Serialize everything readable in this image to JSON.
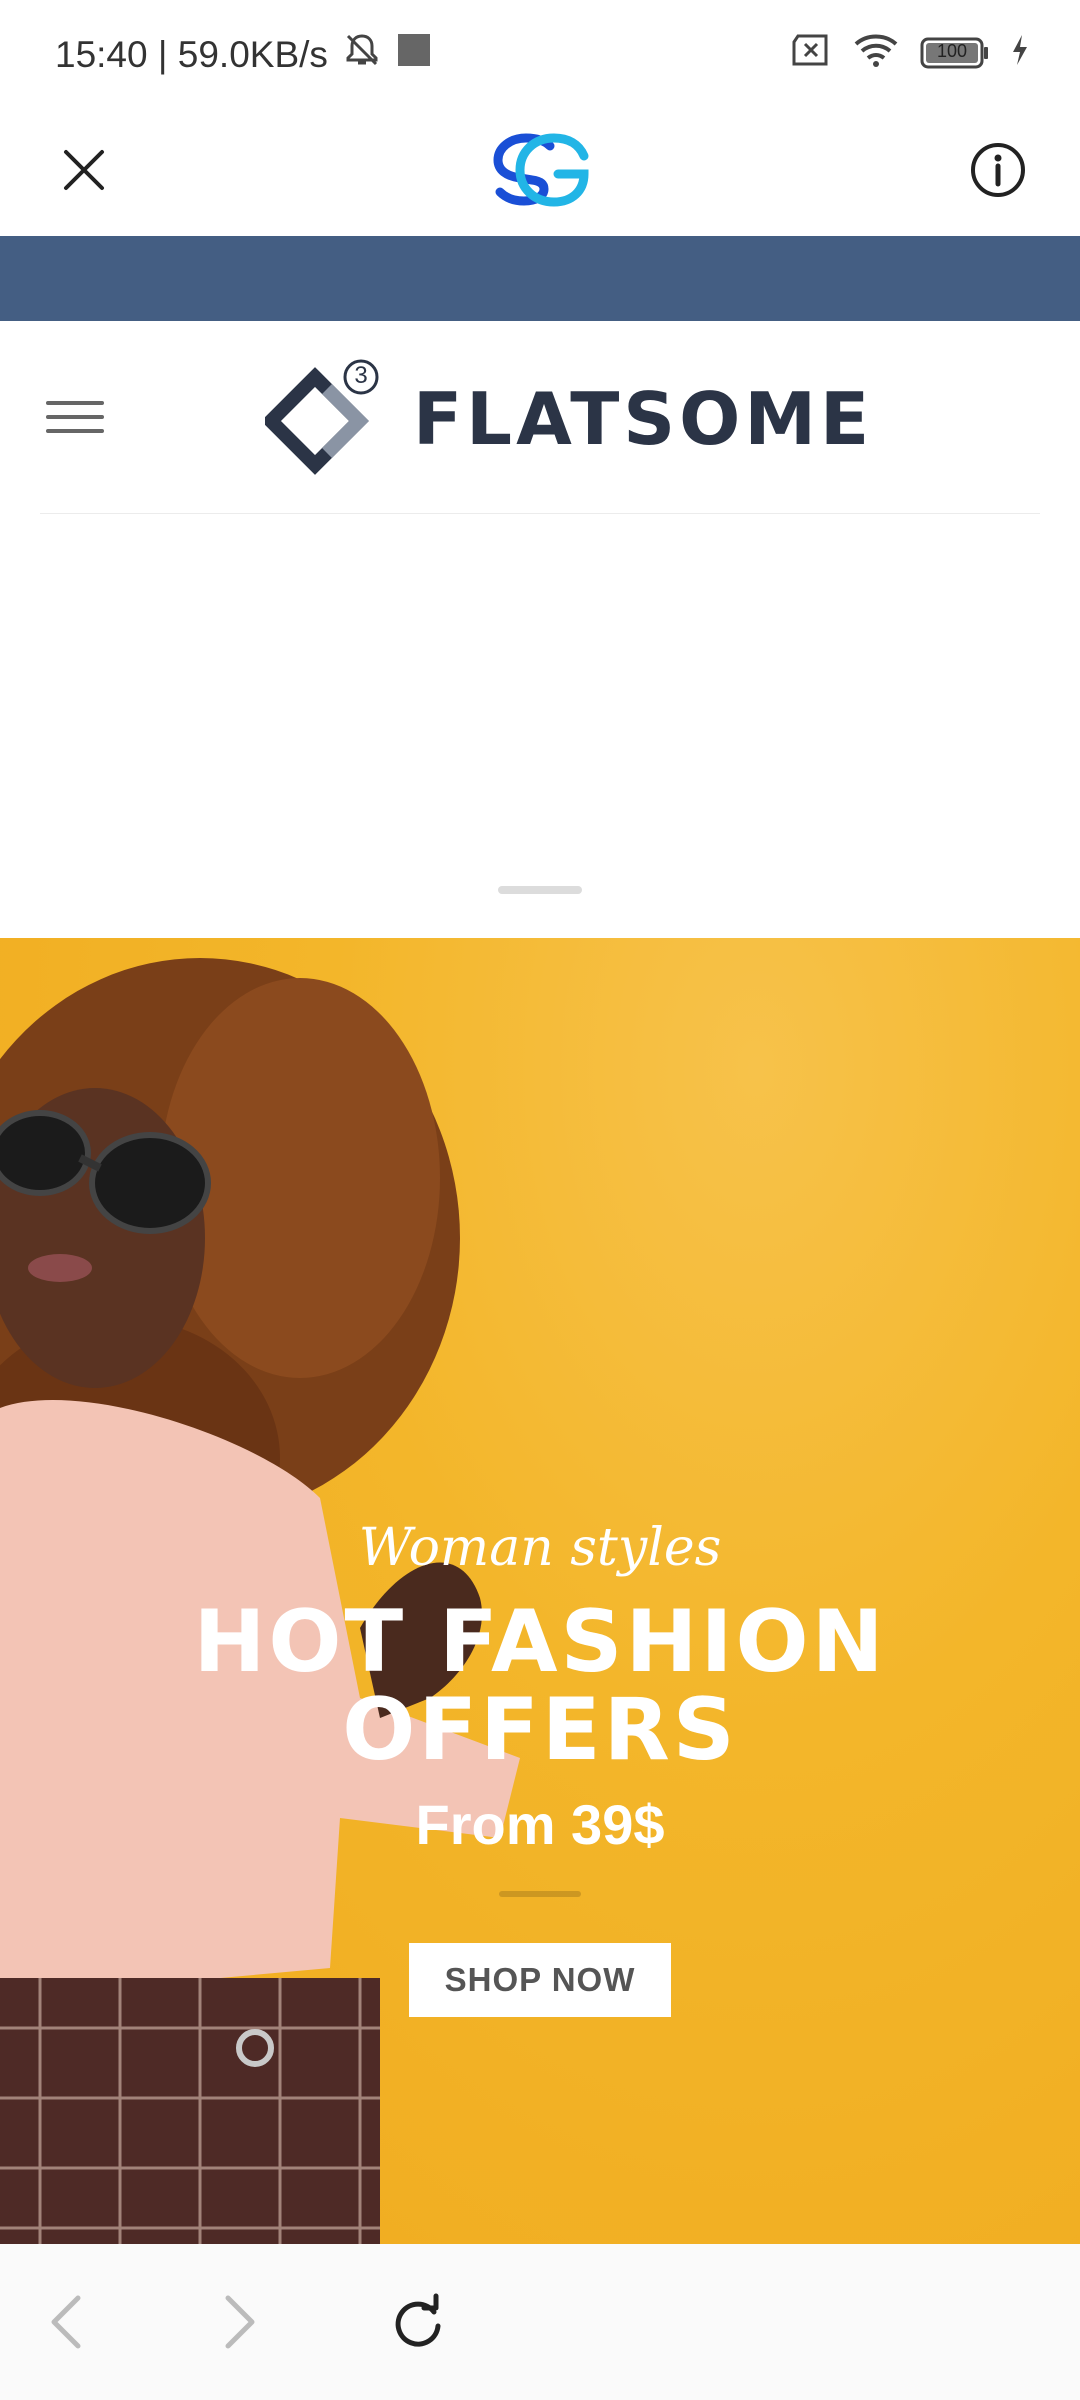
{
  "status": {
    "time_speed": "15:40 | 59.0KB/s",
    "battery": "100"
  },
  "appbar": {
    "icons": [
      "close-icon",
      "sg-logo",
      "info-icon"
    ]
  },
  "site": {
    "logo_badge": "3",
    "logo_text": "FLATSOME"
  },
  "hero": {
    "kicker": "Woman styles",
    "title_line1": "HOT FASHION",
    "title_line2": "OFFERS",
    "subtitle": "From 39$",
    "button_label": "SHOP NOW"
  },
  "colors": {
    "topbar": "#445e83",
    "hero_background": "#f3b62a",
    "logo_dark": "#2b3446"
  },
  "bottom_nav": {
    "icons": [
      "back-icon",
      "forward-icon",
      "reload-icon"
    ]
  }
}
